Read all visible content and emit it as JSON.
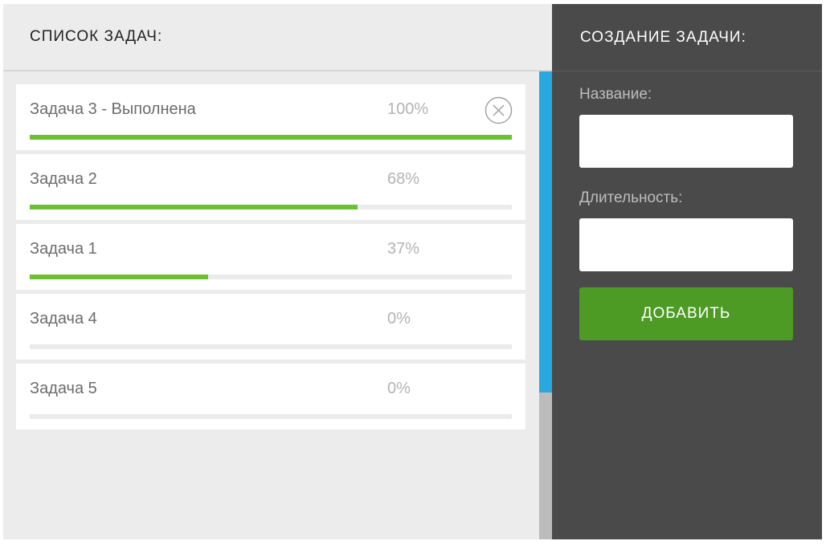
{
  "task_list": {
    "title": "СПИСОК ЗАДАЧ:",
    "tasks": [
      {
        "name": "Задача 3 - Выполнена",
        "percent_text": "100%",
        "progress": 1.0,
        "delete_icon": "circle-x-icon"
      },
      {
        "name": "Задача 2",
        "percent_text": "68%",
        "progress": 0.68
      },
      {
        "name": "Задача 1",
        "percent_text": "37%",
        "progress": 0.37
      },
      {
        "name": "Задача 4",
        "percent_text": "0%",
        "progress": 0.0
      },
      {
        "name": "Задача 5",
        "percent_text": "0%",
        "progress": 0.0
      }
    ]
  },
  "create_task": {
    "title": "СОЗДАНИЕ ЗАДАЧИ:",
    "name_label": "Название:",
    "name_value": "",
    "duration_label": "Длительность:",
    "duration_value": "",
    "add_button_label": "ДОБАВИТЬ"
  },
  "colors": {
    "progress_fill": "#6bc12e",
    "scroll_thumb": "#29a8e0",
    "add_button": "#4d9a24",
    "right_panel_bg": "#4a4a4a",
    "left_panel_bg": "#ececec"
  }
}
